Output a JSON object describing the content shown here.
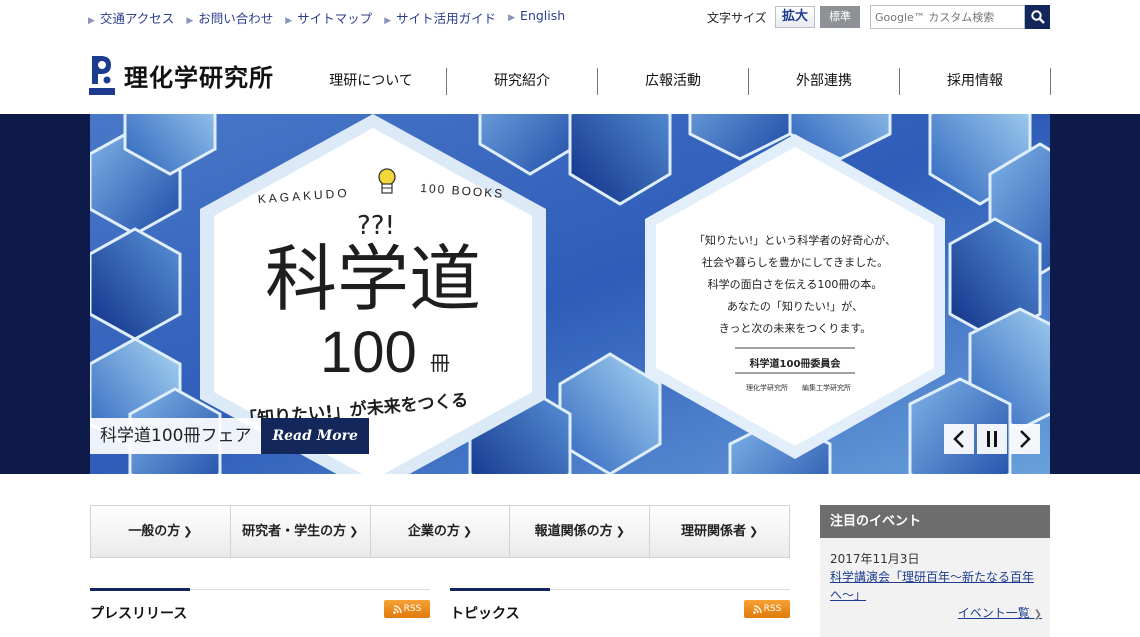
{
  "utility": {
    "links": [
      "交通アクセス",
      "お問い合わせ",
      "サイトマップ",
      "サイト活用ガイド",
      "English"
    ],
    "font_size_label": "文字サイズ",
    "font_size_large": "拡大",
    "font_size_standard": "標準",
    "search_placeholder": "Google™ カスタム検索"
  },
  "header": {
    "logo_text": "理化学研究所",
    "nav": [
      "理研について",
      "研究紹介",
      "広報活動",
      "外部連携",
      "採用情報"
    ]
  },
  "hero": {
    "top_left": "KAGAKUDO",
    "top_right": "100 BOOKS",
    "question": "??!",
    "title": "科学道",
    "number": "100",
    "unit": "冊",
    "tagline": "「知りたい!」が未来をつくる",
    "message": [
      "「知りたい!」という科学者の好奇心が、",
      "社会や暮らしを豊かにしてきました。",
      "科学の面白さを伝える100冊の本。",
      "あなたの「知りたい!」が、",
      "きっと次の未来をつくります。"
    ],
    "committee": "科学道100冊委員会",
    "publisher_1": "理化学研究所",
    "publisher_2": "編集工学研究所",
    "caption_title": "科学道100冊フェア",
    "read_more": "Read More"
  },
  "audience": [
    "一般の方",
    "研究者・学生の方",
    "企業の方",
    "報道関係の方",
    "理研関係者"
  ],
  "sections": {
    "press": "プレスリリース",
    "topics": "トピックス",
    "rss_label": "RSS"
  },
  "event": {
    "heading": "注目のイベント",
    "date": "2017年11月3日",
    "title": "科学講演会「理研百年～新たなる百年へ～」",
    "more": "イベント一覧"
  },
  "colors": {
    "navy": "#14275b",
    "link": "#2b3e8f",
    "rss": "#e8870f",
    "event_head": "#6d6d6d"
  }
}
